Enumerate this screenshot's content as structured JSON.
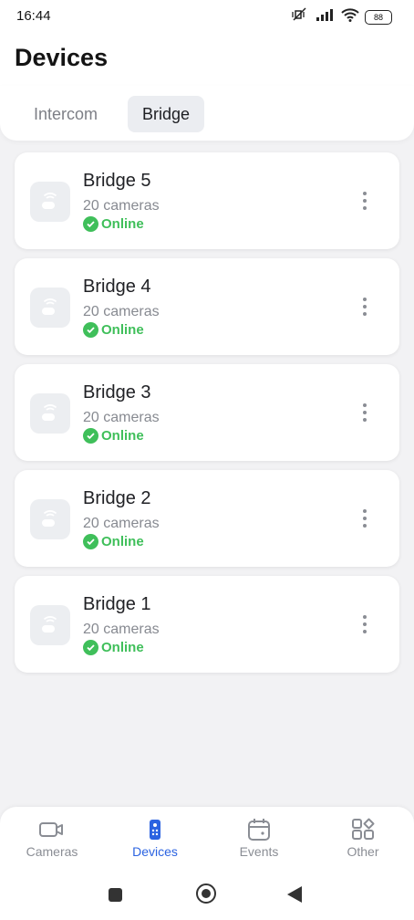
{
  "status_bar": {
    "time": "16:44",
    "battery": "88",
    "icons": [
      "mute-vibrate-icon",
      "signal-icon",
      "wifi-icon",
      "battery-icon"
    ]
  },
  "header": {
    "title": "Devices"
  },
  "tabs": [
    {
      "label": "Intercom",
      "active": false
    },
    {
      "label": "Bridge",
      "active": true
    }
  ],
  "devices": [
    {
      "name": "Bridge 5",
      "cameras": "20 cameras",
      "status": "Online",
      "icon": "bridge-icon"
    },
    {
      "name": "Bridge 4",
      "cameras": "20 cameras",
      "status": "Online",
      "icon": "bridge-icon"
    },
    {
      "name": "Bridge 3",
      "cameras": "20 cameras",
      "status": "Online",
      "icon": "bridge-icon"
    },
    {
      "name": "Bridge 2",
      "cameras": "20 cameras",
      "status": "Online",
      "icon": "bridge-icon"
    },
    {
      "name": "Bridge 1",
      "cameras": "20 cameras",
      "status": "Online",
      "icon": "bridge-icon"
    }
  ],
  "bottom_nav": [
    {
      "label": "Cameras",
      "icon": "camera-icon",
      "active": false
    },
    {
      "label": "Devices",
      "icon": "remote-icon",
      "active": true
    },
    {
      "label": "Events",
      "icon": "calendar-icon",
      "active": false
    },
    {
      "label": "Other",
      "icon": "grid-icon",
      "active": false
    }
  ],
  "colors": {
    "accent": "#2b63e1",
    "online": "#3fbf5a",
    "background": "#f2f2f4"
  }
}
